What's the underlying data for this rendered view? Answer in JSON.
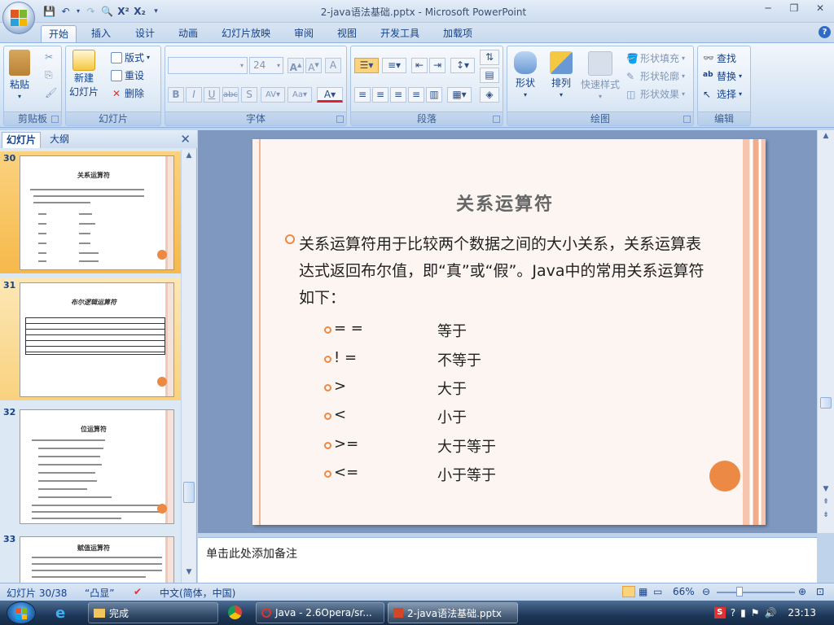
{
  "window": {
    "title": "2-java语法基础.pptx - Microsoft PowerPoint",
    "controls": [
      "─",
      "❐",
      "✕"
    ]
  },
  "ribbon_tabs": [
    "开始",
    "插入",
    "设计",
    "动画",
    "幻灯片放映",
    "审阅",
    "视图",
    "开发工具",
    "加载项"
  ],
  "ribbon": {
    "clipboard": {
      "paste": "粘贴",
      "label": "剪贴板"
    },
    "slides": {
      "new_slide": "新建",
      "new_slide2": "幻灯片",
      "layout": "版式",
      "reset": "重设",
      "delete": "删除",
      "label": "幻灯片"
    },
    "font": {
      "size": "24",
      "label": "字体"
    },
    "paragraph": {
      "label": "段落"
    },
    "drawing": {
      "shape": "形状",
      "arrange": "排列",
      "quick_styles": "快速样式",
      "fill": "形状填充",
      "outline": "形状轮廓",
      "effects": "形状效果",
      "label": "绘图"
    },
    "editing": {
      "find": "查找",
      "replace": "替换",
      "select": "选择",
      "label": "编辑"
    }
  },
  "left_pane": {
    "tabs": [
      "幻灯片",
      "大纲"
    ],
    "thumbnails": [
      {
        "num": "30",
        "title": "关系运算符"
      },
      {
        "num": "31",
        "title": "布尔逻辑运算符"
      },
      {
        "num": "32",
        "title": "位运算符"
      },
      {
        "num": "33",
        "title": "赋值运算符"
      }
    ]
  },
  "slide": {
    "title": "关系运算符",
    "paragraph": "关系运算符用于比较两个数据之间的大小关系，关系运算表达式返回布尔值，即“真”或“假”。Java中的常用关系运算符如下：",
    "operators": [
      {
        "sym": "= =",
        "desc": "等于"
      },
      {
        "sym": "! =",
        "desc": "不等于"
      },
      {
        "sym": ">",
        "desc": "大于"
      },
      {
        "sym": "<",
        "desc": "小于"
      },
      {
        "sym": ">=",
        "desc": "大于等于"
      },
      {
        "sym": "<=",
        "desc": "小于等于"
      }
    ]
  },
  "notes": {
    "placeholder": "单击此处添加备注"
  },
  "status": {
    "slide_count": "幻灯片 30/38",
    "theme": "“凸显”",
    "language": "中文(简体，中国)",
    "zoom": "66%"
  },
  "taskbar": {
    "items": [
      "完成",
      "Java - 2.6Opera/sr...",
      "2-java语法基础.pptx"
    ],
    "clock": "23:13"
  },
  "colors": {
    "accent": "#ec8a45",
    "ribbon_text": "#15428b",
    "selected_thumb": "#f6b94b"
  }
}
